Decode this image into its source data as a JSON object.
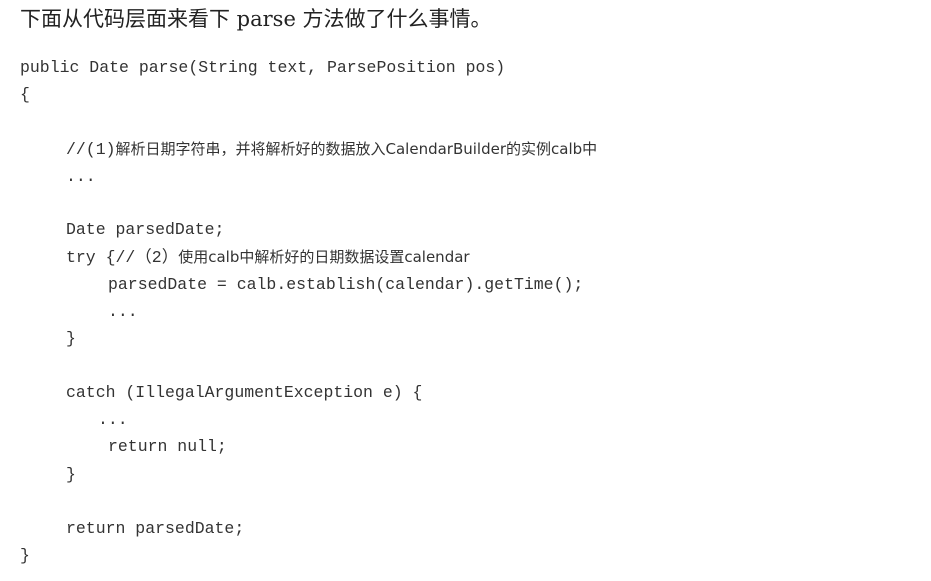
{
  "intro_text": "下面从代码层面来看下 parse 方法做了什么事情。",
  "code": {
    "signature": "public Date parse(String text, ParsePosition pos)",
    "open_brace": "{",
    "comment1_prefix": "//(1)",
    "comment1_body": "解析日期字符串，并将解析好的数据放入CalendarBuilder的实例calb中",
    "ellipsis1": "...",
    "decl": "Date parsedDate;",
    "try_prefix": "try {//（2）",
    "try_comment": "使用calb中解析好的日期数据设置calendar",
    "assign": "parsedDate = calb.establish(calendar).getTime();",
    "ellipsis2": "...",
    "close_try": "}",
    "catch_line": "catch (IllegalArgumentException e) {",
    "ellipsis3": "...",
    "return_null": "return null;",
    "close_catch": "}",
    "return_parsed": "return parsedDate;",
    "close_method": "}"
  }
}
